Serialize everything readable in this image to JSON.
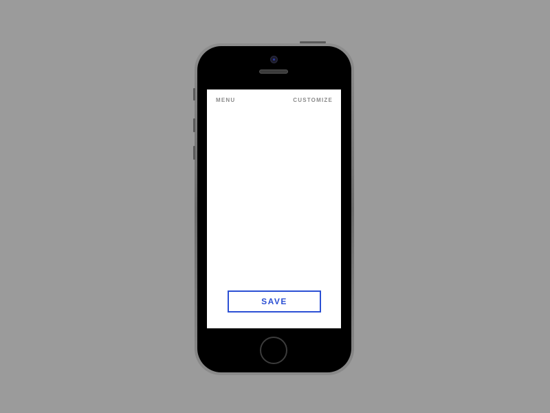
{
  "colors": {
    "background": "#9b9b9b",
    "screen": "#ffffff",
    "nav_text": "#8a8a8a",
    "accent": "#2b4fd4",
    "phone_body": "#000000"
  },
  "nav": {
    "menu_label": "MENU",
    "customize_label": "CUSTOMIZE"
  },
  "actions": {
    "save_label": "SAVE"
  },
  "device": {
    "icons": [
      "front-camera-icon",
      "earpiece-speaker-icon",
      "home-button-icon"
    ]
  }
}
